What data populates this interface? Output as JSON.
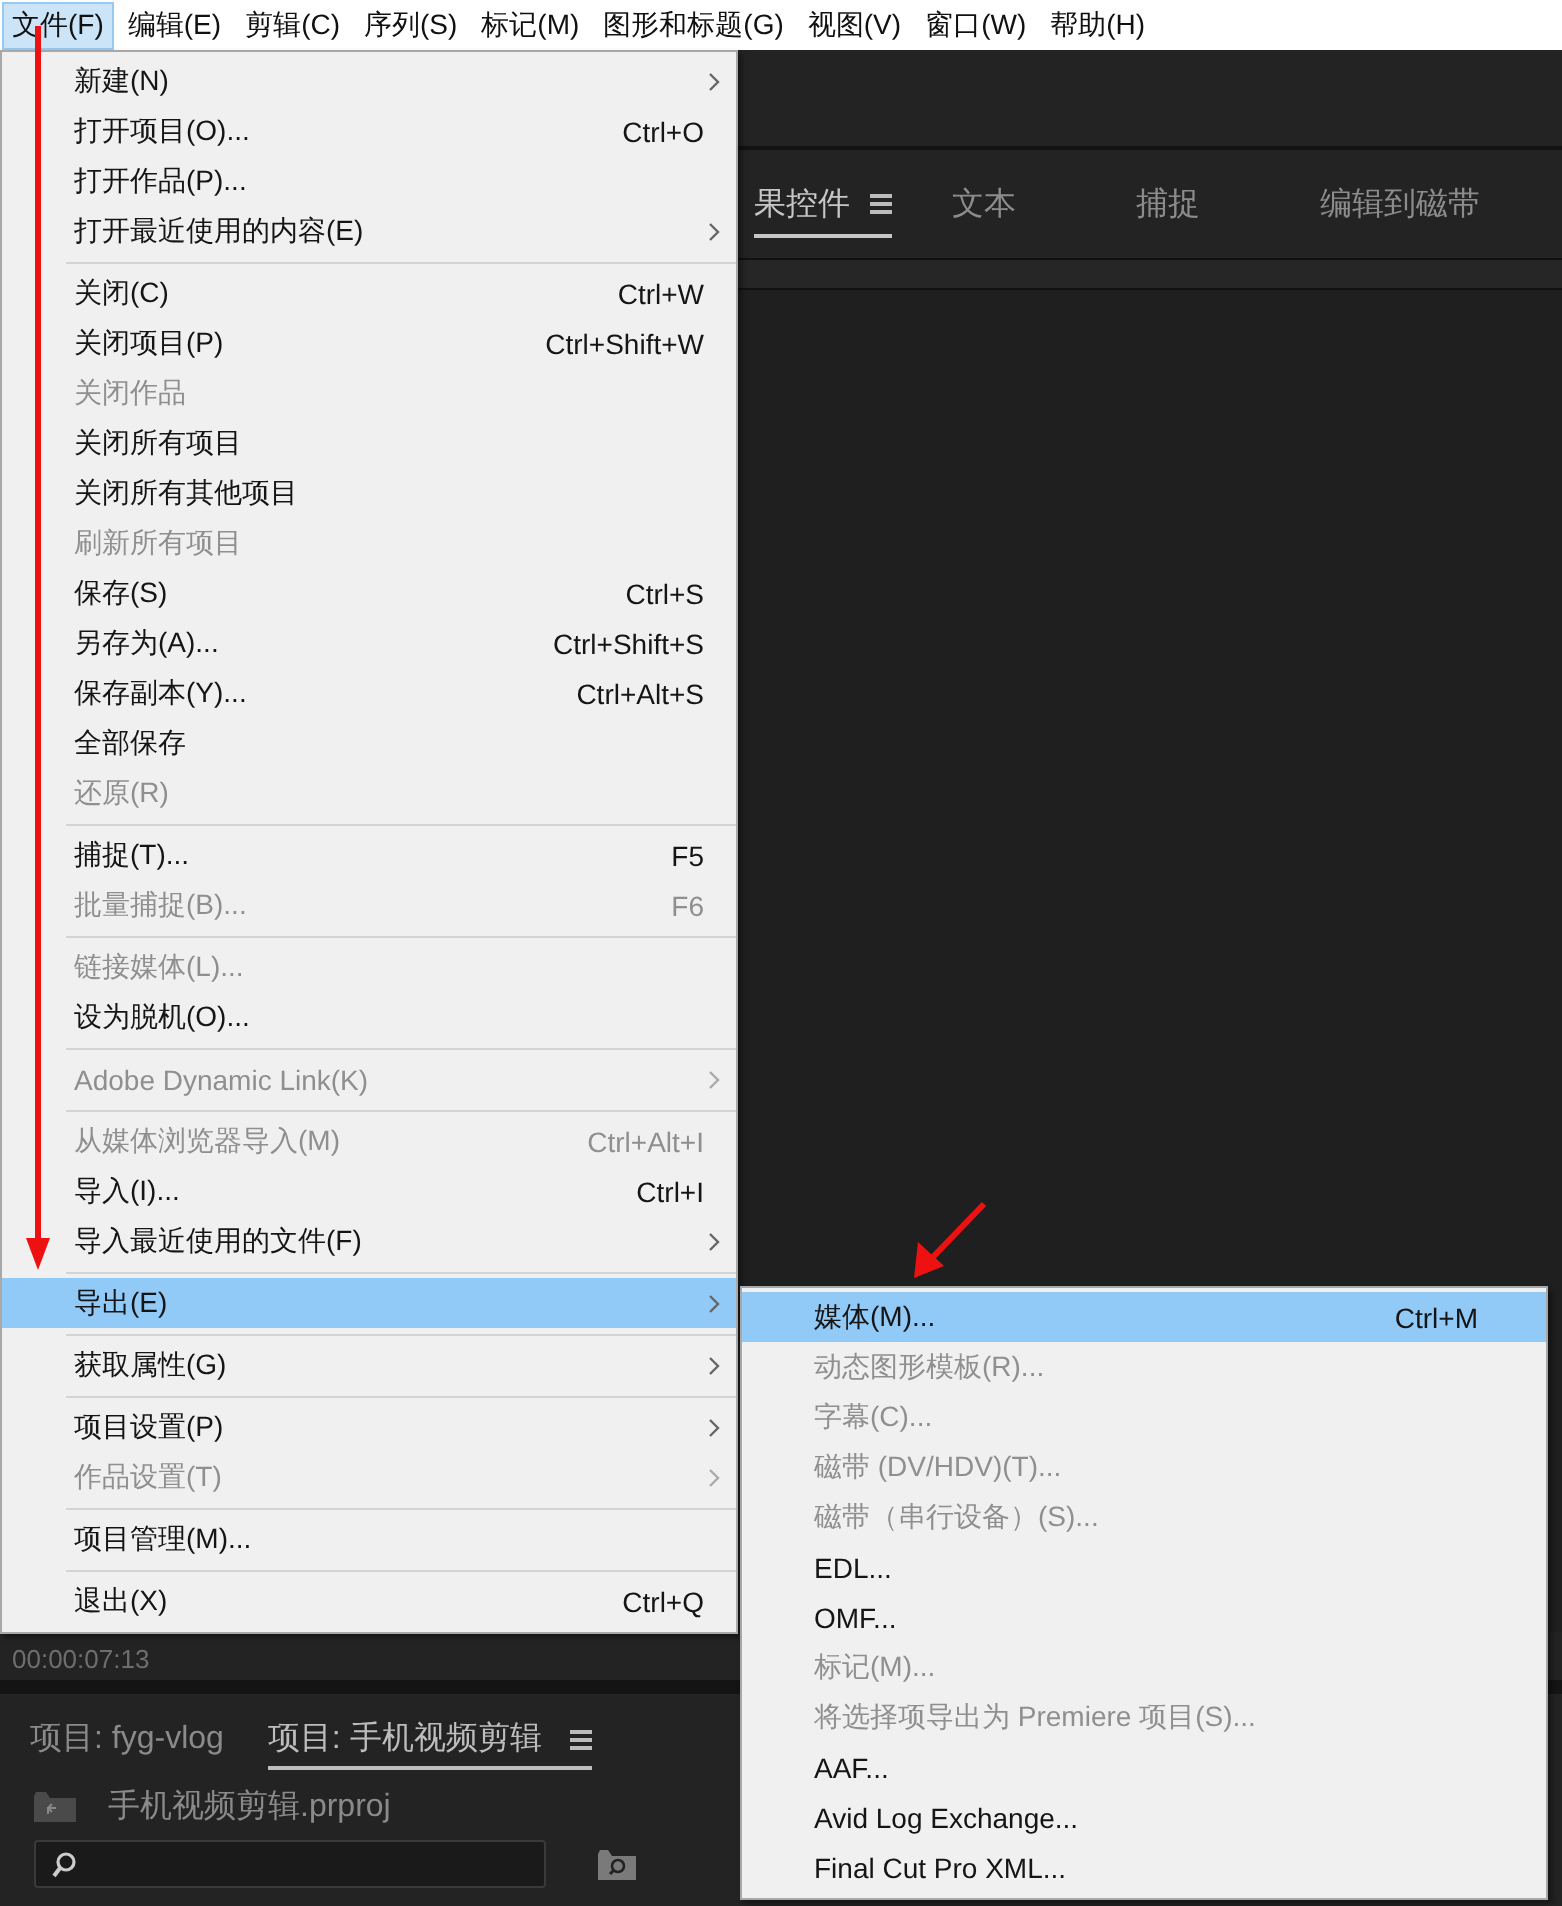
{
  "menubar": {
    "items": [
      {
        "label": "文件(F)",
        "selected": true
      },
      {
        "label": "编辑(E)",
        "selected": false
      },
      {
        "label": "剪辑(C)",
        "selected": false
      },
      {
        "label": "序列(S)",
        "selected": false
      },
      {
        "label": "标记(M)",
        "selected": false
      },
      {
        "label": "图形和标题(G)",
        "selected": false
      },
      {
        "label": "视图(V)",
        "selected": false
      },
      {
        "label": "窗口(W)",
        "selected": false
      },
      {
        "label": "帮助(H)",
        "selected": false
      }
    ]
  },
  "panel_tabs": [
    {
      "label": "果控件",
      "selected": true
    },
    {
      "label": "文本",
      "selected": false
    },
    {
      "label": "捕捉",
      "selected": false
    },
    {
      "label": "编辑到磁带",
      "selected": false
    }
  ],
  "timecode": "00:00:07:13",
  "project_panel": {
    "tabs": [
      {
        "label": "项目: fyg-vlog",
        "selected": false
      },
      {
        "label": "项目: 手机视频剪辑",
        "selected": true
      }
    ],
    "file": "手机视频剪辑.prproj"
  },
  "file_menu": {
    "groups": [
      [
        {
          "label": "新建(N)",
          "disabled": false,
          "submenu": true,
          "selected": false
        },
        {
          "label": "打开项目(O)...",
          "shortcut": "Ctrl+O",
          "disabled": false,
          "submenu": false,
          "selected": false
        },
        {
          "label": "打开作品(P)...",
          "disabled": false,
          "submenu": false,
          "selected": false
        },
        {
          "label": "打开最近使用的内容(E)",
          "disabled": false,
          "submenu": true,
          "selected": false
        }
      ],
      [
        {
          "label": "关闭(C)",
          "shortcut": "Ctrl+W",
          "disabled": false,
          "submenu": false,
          "selected": false
        },
        {
          "label": "关闭项目(P)",
          "shortcut": "Ctrl+Shift+W",
          "disabled": false,
          "submenu": false,
          "selected": false
        },
        {
          "label": "关闭作品",
          "disabled": true,
          "submenu": false,
          "selected": false
        },
        {
          "label": "关闭所有项目",
          "disabled": false,
          "submenu": false,
          "selected": false
        },
        {
          "label": "关闭所有其他项目",
          "disabled": false,
          "submenu": false,
          "selected": false
        },
        {
          "label": "刷新所有项目",
          "disabled": true,
          "submenu": false,
          "selected": false
        },
        {
          "label": "保存(S)",
          "shortcut": "Ctrl+S",
          "disabled": false,
          "submenu": false,
          "selected": false
        },
        {
          "label": "另存为(A)...",
          "shortcut": "Ctrl+Shift+S",
          "disabled": false,
          "submenu": false,
          "selected": false
        },
        {
          "label": "保存副本(Y)...",
          "shortcut": "Ctrl+Alt+S",
          "disabled": false,
          "submenu": false,
          "selected": false
        },
        {
          "label": "全部保存",
          "disabled": false,
          "submenu": false,
          "selected": false
        },
        {
          "label": "还原(R)",
          "disabled": true,
          "submenu": false,
          "selected": false
        }
      ],
      [
        {
          "label": "捕捉(T)...",
          "shortcut": "F5",
          "disabled": false,
          "submenu": false,
          "selected": false
        },
        {
          "label": "批量捕捉(B)...",
          "shortcut": "F6",
          "disabled": true,
          "submenu": false,
          "selected": false
        }
      ],
      [
        {
          "label": "链接媒体(L)...",
          "disabled": true,
          "submenu": false,
          "selected": false
        },
        {
          "label": "设为脱机(O)...",
          "disabled": false,
          "submenu": false,
          "selected": false
        }
      ],
      [
        {
          "label": "Adobe Dynamic Link(K)",
          "disabled": true,
          "submenu": true,
          "selected": false
        }
      ],
      [
        {
          "label": "从媒体浏览器导入(M)",
          "shortcut": "Ctrl+Alt+I",
          "disabled": true,
          "submenu": false,
          "selected": false
        },
        {
          "label": "导入(I)...",
          "shortcut": "Ctrl+I",
          "disabled": false,
          "submenu": false,
          "selected": false
        },
        {
          "label": "导入最近使用的文件(F)",
          "disabled": false,
          "submenu": true,
          "selected": false
        }
      ],
      [
        {
          "label": "导出(E)",
          "disabled": false,
          "submenu": true,
          "selected": true
        }
      ],
      [
        {
          "label": "获取属性(G)",
          "disabled": false,
          "submenu": true,
          "selected": false
        }
      ],
      [
        {
          "label": "项目设置(P)",
          "disabled": false,
          "submenu": true,
          "selected": false
        },
        {
          "label": "作品设置(T)",
          "disabled": true,
          "submenu": true,
          "selected": false
        }
      ],
      [
        {
          "label": "项目管理(M)...",
          "disabled": false,
          "submenu": false,
          "selected": false
        }
      ],
      [
        {
          "label": "退出(X)",
          "shortcut": "Ctrl+Q",
          "disabled": false,
          "submenu": false,
          "selected": false
        }
      ]
    ]
  },
  "export_submenu": {
    "items": [
      {
        "label": "媒体(M)...",
        "shortcut": "Ctrl+M",
        "disabled": false,
        "selected": true
      },
      {
        "label": "动态图形模板(R)...",
        "disabled": true,
        "selected": false
      },
      {
        "label": "字幕(C)...",
        "disabled": true,
        "selected": false
      },
      {
        "label": "磁带 (DV/HDV)(T)...",
        "disabled": true,
        "selected": false
      },
      {
        "label": "磁带（串行设备）(S)...",
        "disabled": true,
        "selected": false
      },
      {
        "label": "EDL...",
        "disabled": false,
        "selected": false
      },
      {
        "label": "OMF...",
        "disabled": false,
        "selected": false
      },
      {
        "label": "标记(M)...",
        "disabled": true,
        "selected": false
      },
      {
        "label": "将选择项导出为 Premiere 项目(S)...",
        "disabled": true,
        "selected": false
      },
      {
        "label": "AAF...",
        "disabled": false,
        "selected": false
      },
      {
        "label": "Avid Log Exchange...",
        "disabled": false,
        "selected": false
      },
      {
        "label": "Final Cut Pro XML...",
        "disabled": false,
        "selected": false
      }
    ]
  }
}
